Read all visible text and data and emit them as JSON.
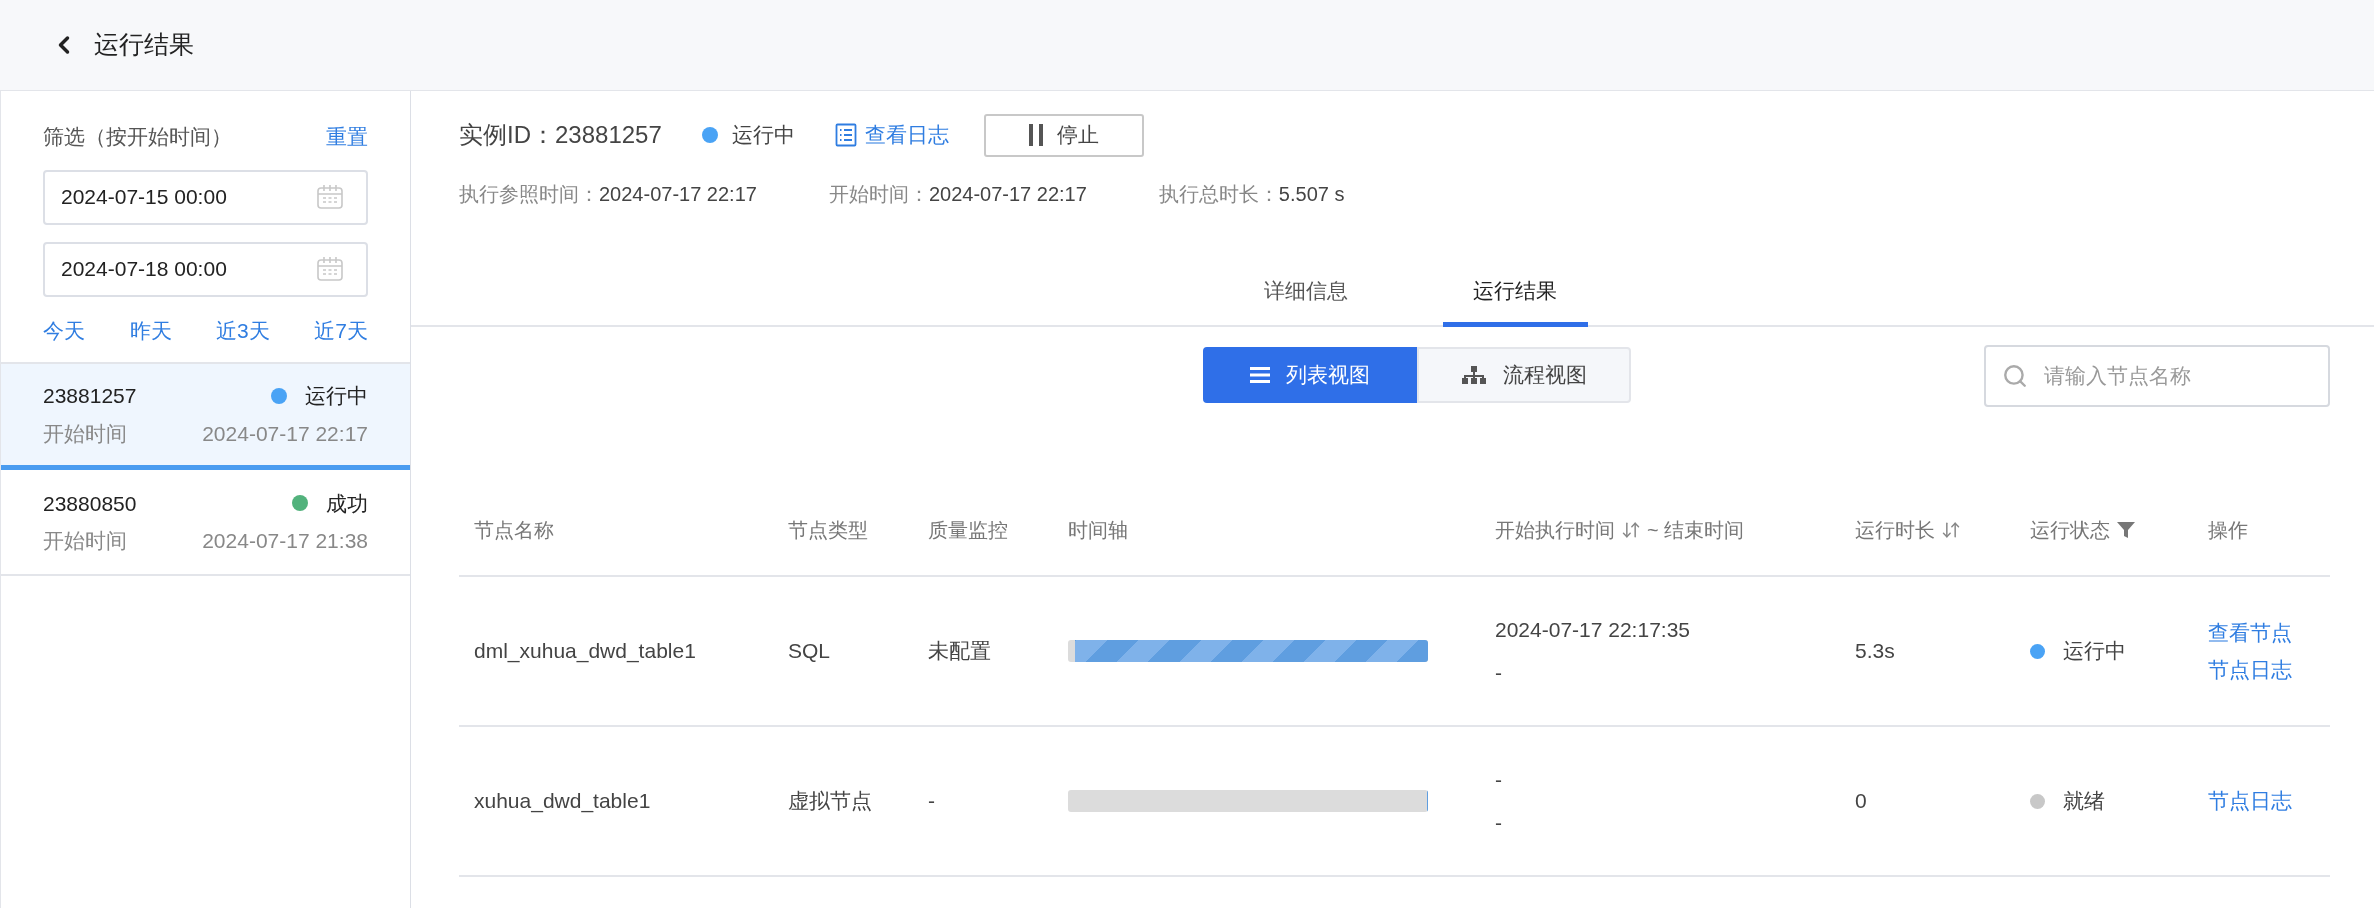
{
  "header": {
    "title": "运行结果"
  },
  "filter": {
    "title": "筛选（按开始时间）",
    "reset": "重置",
    "start_date": "2024-07-15 00:00",
    "end_date": "2024-07-18 00:00",
    "quick_ranges": [
      "今天",
      "昨天",
      "近3天",
      "近7天"
    ]
  },
  "runs": [
    {
      "id": "23881257",
      "status": "运行中",
      "color": "#4aa3f5",
      "start_label": "开始时间",
      "start_time": "2024-07-17 22:17",
      "selected": true
    },
    {
      "id": "23880850",
      "status": "成功",
      "color": "#52b27c",
      "start_label": "开始时间",
      "start_time": "2024-07-17 21:38",
      "selected": false
    }
  ],
  "instance": {
    "id_label": "实例ID：",
    "id": "23881257",
    "status": "运行中",
    "color": "#4aa3f5",
    "log_link": "查看日志",
    "stop_button": "停止",
    "meta": [
      {
        "label": "执行参照时间：",
        "value": "2024-07-17 22:17"
      },
      {
        "label": "开始时间：",
        "value": "2024-07-17 22:17"
      },
      {
        "label": "执行总时长：",
        "value": "5.507 s"
      }
    ]
  },
  "tabs": [
    {
      "label": "详细信息",
      "selected": false
    },
    {
      "label": "运行结果",
      "selected": true
    }
  ],
  "views": [
    {
      "label": "列表视图",
      "kind": "list",
      "selected": true
    },
    {
      "label": "流程视图",
      "kind": "flow",
      "selected": false
    }
  ],
  "search": {
    "placeholder": "请输入节点名称"
  },
  "table": {
    "columns": [
      {
        "label": "节点名称"
      },
      {
        "label": "节点类型"
      },
      {
        "label": "质量监控"
      },
      {
        "label": "时间轴"
      },
      {
        "label": "开始执行时间",
        "kind": "sort",
        "suffix": "~ 结束时间"
      },
      {
        "label": "运行时长",
        "kind": "sort"
      },
      {
        "label": "运行状态",
        "kind": "filter"
      },
      {
        "label": "操作"
      }
    ],
    "rows": [
      {
        "name": "dml_xuhua_dwd_table1",
        "type": "SQL",
        "quality": "未配置",
        "level": 0.98,
        "start": "2024-07-17 22:17:35",
        "end": "-",
        "duration": "5.3s",
        "status": "运行中",
        "color": "#4aa3f5",
        "actions": [
          "查看节点",
          "节点日志"
        ]
      },
      {
        "name": "xuhua_dwd_table1",
        "type": "虚拟节点",
        "quality": "-",
        "level": 0,
        "start": "-",
        "end": "-",
        "duration": "0",
        "status": "就绪",
        "color": "#c8c8c8",
        "actions": [
          "节点日志"
        ]
      }
    ]
  }
}
